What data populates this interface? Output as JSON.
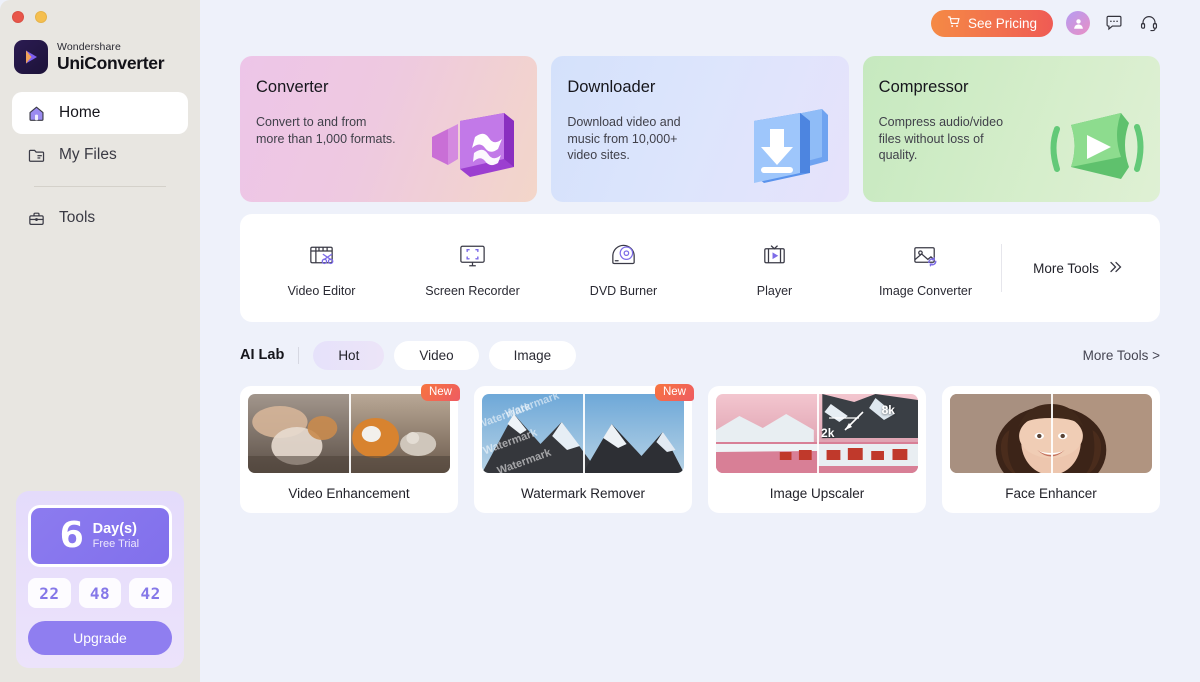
{
  "window": {
    "controls": [
      "close",
      "minimize"
    ]
  },
  "sidebar": {
    "brand": {
      "top": "Wondershare",
      "bottom": "UniConverter"
    },
    "items": [
      {
        "label": "Home",
        "icon": "home-icon",
        "active": true
      },
      {
        "label": "My Files",
        "icon": "folder-icon",
        "active": false
      },
      {
        "label": "Tools",
        "icon": "toolbox-icon",
        "active": false
      }
    ],
    "trial": {
      "days": "6",
      "days_label": "Day(s)",
      "free_label": "Free Trial",
      "hours": "22",
      "minutes": "48",
      "seconds": "42",
      "upgrade_label": "Upgrade"
    }
  },
  "header": {
    "pricing_label": "See Pricing",
    "pricing_icon": "cart-icon",
    "icons": [
      "avatar",
      "chat-icon",
      "headset-icon"
    ]
  },
  "features": [
    {
      "title": "Converter",
      "desc": "Convert to and from more than 1,000 formats.",
      "art": "video-camera-3d-icon"
    },
    {
      "title": "Downloader",
      "desc": "Download video and music from 10,000+ video sites.",
      "art": "download-arrow-3d-icon"
    },
    {
      "title": "Compressor",
      "desc": "Compress audio/video files without loss of quality.",
      "art": "compress-play-3d-icon"
    }
  ],
  "tools": {
    "items": [
      {
        "label": "Video Editor",
        "icon": "film-scissors-icon"
      },
      {
        "label": "Screen Recorder",
        "icon": "monitor-frame-icon"
      },
      {
        "label": "DVD Burner",
        "icon": "disc-icon"
      },
      {
        "label": "Player",
        "icon": "tv-play-icon"
      },
      {
        "label": "Image Converter",
        "icon": "image-refresh-icon"
      }
    ],
    "more_label": "More Tools",
    "more_icon": "double-chevron-right-icon"
  },
  "ailab": {
    "title": "AI Lab",
    "tabs": [
      {
        "label": "Hot",
        "active": true
      },
      {
        "label": "Video",
        "active": false
      },
      {
        "label": "Image",
        "active": false
      }
    ],
    "more_label": "More Tools >",
    "cards": [
      {
        "label": "Video Enhancement",
        "badge": "New"
      },
      {
        "label": "Watermark Remover",
        "badge": "New",
        "watermark_text": "Watermark"
      },
      {
        "label": "Image Upscaler",
        "badge": "",
        "from_res": "2k",
        "to_res": "8k"
      },
      {
        "label": "Face Enhancer",
        "badge": ""
      }
    ]
  },
  "colors": {
    "accent": "#8f7ef0",
    "pricing_from": "#f58a45",
    "pricing_to": "#ef5b54",
    "sidebar_bg": "#e8e6e1",
    "main_bg": "#eef1fa",
    "badge_from": "#f7753f",
    "badge_to": "#ee5b62"
  }
}
